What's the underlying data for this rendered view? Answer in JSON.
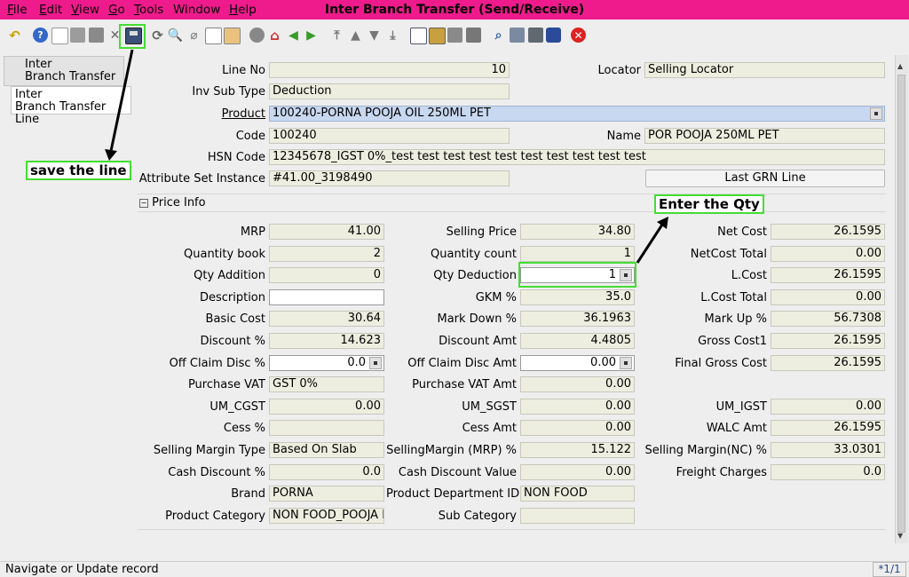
{
  "menu": {
    "items": [
      {
        "first": "F",
        "rest": "ile"
      },
      {
        "first": "E",
        "rest": "dit"
      },
      {
        "first": "V",
        "rest": "iew"
      },
      {
        "first": "G",
        "rest": "o"
      },
      {
        "first": "T",
        "rest": "ools"
      },
      {
        "first": "",
        "rest": "Window"
      },
      {
        "first": "H",
        "rest": "elp"
      }
    ]
  },
  "window_title": "Inter Branch Transfer (Send/Receive)",
  "tabs": [
    {
      "line1": "Inter",
      "line2": "Branch Transfer"
    },
    {
      "line1": "Inter",
      "line2": "Branch Transfer Line"
    }
  ],
  "form": {
    "line_no": {
      "label": "Line No",
      "value": "10"
    },
    "locator": {
      "label": "Locator",
      "value": "Selling Locator"
    },
    "inv_sub_type": {
      "label": "Inv Sub Type",
      "value": "Deduction"
    },
    "product": {
      "label": "Product",
      "value": "100240-PORNA POOJA OIL 250ML PET"
    },
    "code": {
      "label": "Code",
      "value": "100240"
    },
    "name": {
      "label": "Name",
      "value": "POR POOJA 250ML PET"
    },
    "hsn_code": {
      "label": "HSN Code",
      "value": "12345678_IGST 0%_test test test test test test test test test test"
    },
    "attribute_set_instance": {
      "label": "Attribute Set Instance",
      "value": "#41.00_3198490"
    },
    "last_grn_button": "Last GRN Line"
  },
  "price_info": {
    "section_label": "Price Info",
    "col1": [
      {
        "label": "MRP",
        "value": "41.00",
        "style": "num"
      },
      {
        "label": "Quantity book",
        "value": "2",
        "style": "num"
      },
      {
        "label": "Qty Addition",
        "value": "0",
        "style": "num"
      },
      {
        "label": "Description",
        "value": "",
        "style": "white"
      },
      {
        "label": "Basic Cost",
        "value": "30.64",
        "style": "num"
      },
      {
        "label": "Discount %",
        "value": "14.623",
        "style": "num"
      },
      {
        "label": "Off Claim Disc %",
        "value": "0.0",
        "style": "white-num-mini"
      },
      {
        "label": "Purchase VAT",
        "value": "GST 0%",
        "style": "text"
      },
      {
        "label": "UM_CGST",
        "value": "0.00",
        "style": "num"
      },
      {
        "label": "Cess %",
        "value": "",
        "style": "num"
      },
      {
        "label": "Selling Margin Type",
        "value": "Based On Slab",
        "style": "text"
      },
      {
        "label": "Cash Discount %",
        "value": "0.0",
        "style": "num"
      },
      {
        "label": "Brand",
        "value": "PORNA",
        "style": "text"
      },
      {
        "label": "Product Category",
        "value": "NON FOOD_POOJA N",
        "style": "text"
      }
    ],
    "col2": [
      {
        "label": "Selling Price",
        "value": "34.80",
        "style": "num"
      },
      {
        "label": "Quantity count",
        "value": "1",
        "style": "num"
      },
      {
        "label": "Qty Deduction",
        "value": "1",
        "style": "white-num-mini"
      },
      {
        "label": "GKM %",
        "value": "35.0",
        "style": "num"
      },
      {
        "label": "Mark Down %",
        "value": "36.1963",
        "style": "num"
      },
      {
        "label": "Discount Amt",
        "value": "4.4805",
        "style": "num"
      },
      {
        "label": "Off Claim Disc Amt",
        "value": "0.00",
        "style": "white-num-mini"
      },
      {
        "label": "Purchase VAT Amt",
        "value": "0.00",
        "style": "num"
      },
      {
        "label": "UM_SGST",
        "value": "0.00",
        "style": "num"
      },
      {
        "label": "Cess Amt",
        "value": "0.00",
        "style": "num"
      },
      {
        "label": "SellingMargin (MRP) %",
        "value": "15.122",
        "style": "num"
      },
      {
        "label": "Cash Discount Value",
        "value": "0.00",
        "style": "num"
      },
      {
        "label": "Product Department ID",
        "value": "NON FOOD",
        "style": "text"
      },
      {
        "label": "Sub Category",
        "value": "",
        "style": "text"
      }
    ],
    "col3": [
      {
        "label": "Net Cost",
        "value": "26.1595",
        "style": "num"
      },
      {
        "label": "NetCost Total",
        "value": "0.00",
        "style": "num"
      },
      {
        "label": "L.Cost",
        "value": "26.1595",
        "style": "num"
      },
      {
        "label": "L.Cost Total",
        "value": "0.00",
        "style": "num"
      },
      {
        "label": "Mark Up %",
        "value": "56.7308",
        "style": "num"
      },
      {
        "label": "Gross Cost1",
        "value": "26.1595",
        "style": "num"
      },
      {
        "label": "Final Gross Cost",
        "value": "26.1595",
        "style": "num"
      },
      null,
      {
        "label": "UM_IGST",
        "value": "0.00",
        "style": "num"
      },
      {
        "label": "WALC Amt",
        "value": "26.1595",
        "style": "num"
      },
      {
        "label": "Selling Margin(NC) %",
        "value": "33.0301",
        "style": "num"
      },
      {
        "label": "Freight Charges",
        "value": "0.0",
        "style": "num"
      },
      null,
      null
    ]
  },
  "annotations": {
    "save": "save the line",
    "qty": "Enter the Qty"
  },
  "status": {
    "message": "Navigate or Update record",
    "record": "*1/1"
  },
  "colors": {
    "menubar": "#ef1b8c",
    "highlight": "#44dd33"
  }
}
